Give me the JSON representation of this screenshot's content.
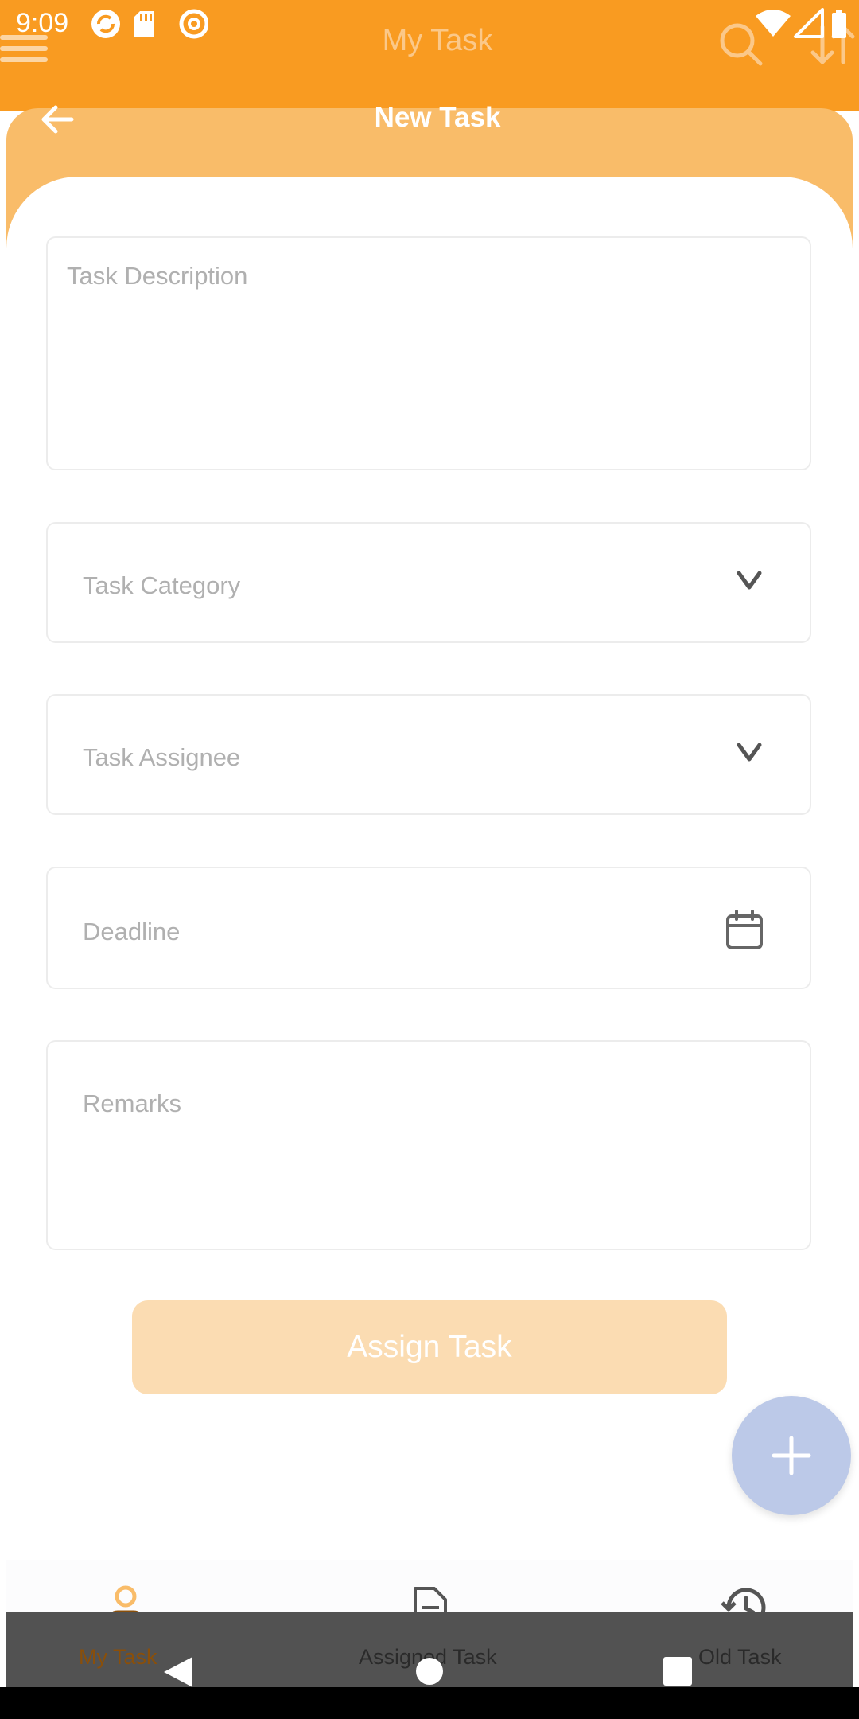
{
  "status_bar": {
    "time": "9:09",
    "left_icons": [
      "sync-icon",
      "sd-card-icon",
      "at-sign-icon"
    ],
    "right_icons": [
      "wifi-icon",
      "signal-icon",
      "battery-icon"
    ]
  },
  "app_bar": {
    "title": "My Task",
    "menu_icon": "hamburger-menu-icon",
    "search_icon": "search-icon",
    "sort_icon": "sort-icon"
  },
  "sheet": {
    "title": "New Task",
    "back_icon": "arrow-left-icon"
  },
  "form": {
    "task_description": {
      "placeholder": "Task Description",
      "value": ""
    },
    "task_category": {
      "placeholder": "Task Category",
      "value": ""
    },
    "task_assignee": {
      "placeholder": "Task Assignee",
      "value": ""
    },
    "deadline": {
      "placeholder": "Deadline",
      "value": ""
    },
    "remarks": {
      "placeholder": "Remarks",
      "value": ""
    },
    "submit_label": "Assign Task"
  },
  "fab": {
    "icon": "plus-icon"
  },
  "bottom_nav": {
    "items": [
      {
        "label": "My Task",
        "icon": "person-icon",
        "active": true
      },
      {
        "label": "Assigned Task",
        "icon": "document-icon",
        "active": false
      },
      {
        "label": "Old Task",
        "icon": "history-icon",
        "active": false
      }
    ]
  },
  "system_nav": {
    "back_icon": "back-triangle-icon",
    "home_icon": "home-circle-icon",
    "recents_icon": "recents-square-icon"
  },
  "colors": {
    "primary": "#f99b21",
    "sheet_header": "#f9bc69",
    "button_disabled": "#fbdcb2",
    "fab": "#bcc9e8",
    "nav_active": "#8a4f0a"
  }
}
